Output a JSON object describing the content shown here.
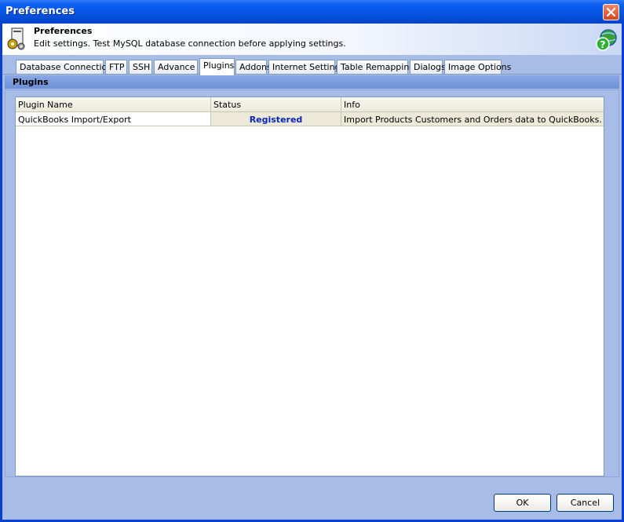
{
  "window": {
    "title": "Preferences",
    "close_icon": "close-icon"
  },
  "header": {
    "title": "Preferences",
    "subtitle": "Edit settings. Test MySQL database connection before applying settings.",
    "icon": "preferences-gears-icon",
    "help_icon": "help-globe-icon"
  },
  "tabs": [
    {
      "label": "Database Connection"
    },
    {
      "label": "FTP"
    },
    {
      "label": "SSH"
    },
    {
      "label": "Advance"
    },
    {
      "label": "Plugins",
      "active": true
    },
    {
      "label": "Addons"
    },
    {
      "label": "Internet Settings"
    },
    {
      "label": "Table Remapping"
    },
    {
      "label": "Dialogs"
    },
    {
      "label": "Image Options"
    }
  ],
  "section": {
    "title": "Plugins"
  },
  "grid": {
    "columns": [
      "Plugin Name",
      "Status",
      "Info"
    ],
    "rows": [
      {
        "name": "QuickBooks Import/Export",
        "status": "Registered",
        "info": "Import Products Customers and Orders data to QuickBooks."
      }
    ]
  },
  "buttons": {
    "ok": "OK",
    "cancel": "Cancel"
  },
  "colors": {
    "titlebar": "#0553e0",
    "client": "#a7bde8",
    "status_text": "#0a25b8"
  }
}
